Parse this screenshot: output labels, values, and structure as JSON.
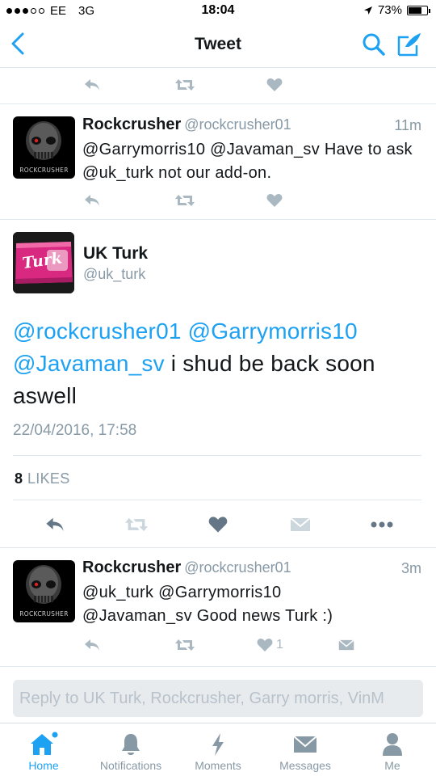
{
  "status_bar": {
    "carrier": "EE",
    "network": "3G",
    "time": "18:04",
    "battery": "73%",
    "battery_level": 0.73,
    "signal_bars": 3
  },
  "nav": {
    "title": "Tweet"
  },
  "tweets_above": [
    {
      "name": "Rockcrusher",
      "handle": "@rockcrusher01",
      "time": "11m",
      "text": "@Garrymorris10 @Javaman_sv Have to ask @uk_turk not our add-on.",
      "avatar_brand": "ROCKCRUSHER"
    }
  ],
  "main_tweet": {
    "name": "UK Turk",
    "handle": "@uk_turk",
    "mentions": [
      "@rockcrusher01",
      "@Garrymorris10",
      "@Javaman_sv"
    ],
    "body": "i shud be back soon aswell",
    "date": "22/04/2016, 17:58",
    "likes_count": "8",
    "likes_label": "LIKES",
    "avatar_text": "Turk"
  },
  "tweets_below": [
    {
      "name": "Rockcrusher",
      "handle": "@rockcrusher01",
      "time": "3m",
      "text": "@uk_turk @Garrymorris10 @Javaman_sv Good news Turk :)",
      "like_count": "1",
      "avatar_brand": "ROCKCRUSHER"
    }
  ],
  "reply": {
    "placeholder": "Reply to UK Turk, Rockcrusher, Garry morris, VinM"
  },
  "tabs": [
    {
      "label": "Home",
      "icon": "home-icon"
    },
    {
      "label": "Notifications",
      "icon": "bell-icon"
    },
    {
      "label": "Moments",
      "icon": "lightning-icon"
    },
    {
      "label": "Messages",
      "icon": "envelope-icon"
    },
    {
      "label": "Me",
      "icon": "person-icon"
    }
  ],
  "colors": {
    "accent": "#1da1f2",
    "secondary_text": "#8899a6",
    "icon_gray": "#aab8c2"
  }
}
